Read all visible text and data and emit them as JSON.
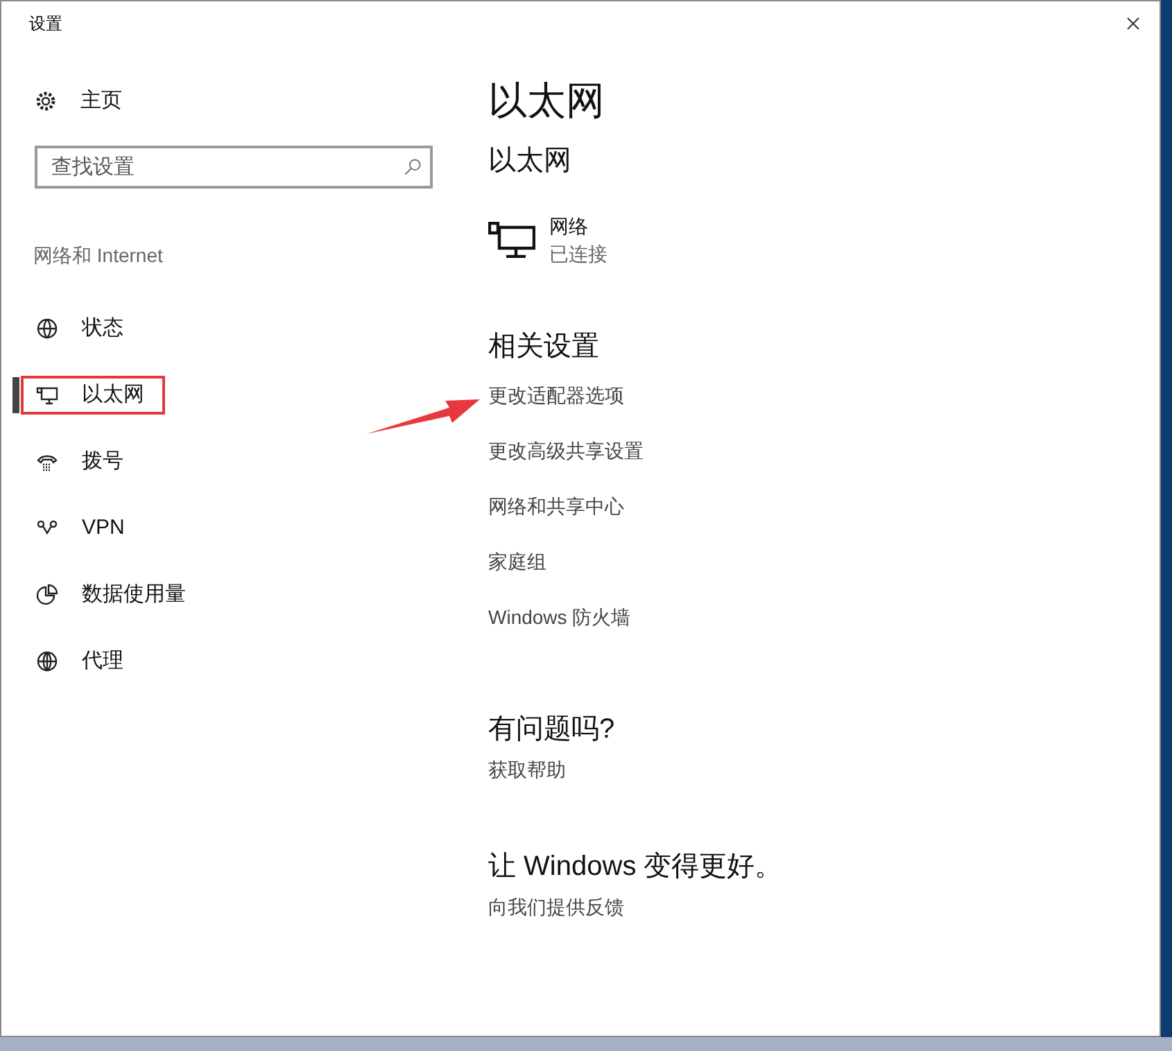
{
  "window": {
    "title": "设置"
  },
  "sidebar": {
    "home": "主页",
    "search": {
      "placeholder": "查找设置"
    },
    "section": "网络和 Internet",
    "items": [
      {
        "label": "状态",
        "selected": false,
        "annotated": false
      },
      {
        "label": "以太网",
        "selected": true,
        "annotated": true
      },
      {
        "label": "拨号",
        "selected": false,
        "annotated": false
      },
      {
        "label": "VPN",
        "selected": false,
        "annotated": false
      },
      {
        "label": "数据使用量",
        "selected": false,
        "annotated": false
      },
      {
        "label": "代理",
        "selected": false,
        "annotated": false
      }
    ]
  },
  "content": {
    "title": "以太网",
    "subtitle": "以太网",
    "network": {
      "name": "网络",
      "status": "已连接"
    },
    "related": {
      "heading": "相关设置",
      "links": [
        "更改适配器选项",
        "更改高级共享设置",
        "网络和共享中心",
        "家庭组",
        "Windows 防火墙"
      ]
    },
    "help": {
      "heading": "有问题吗?",
      "link": "获取帮助"
    },
    "feedback": {
      "heading": "让 Windows 变得更好。",
      "link": "向我们提供反馈"
    }
  }
}
